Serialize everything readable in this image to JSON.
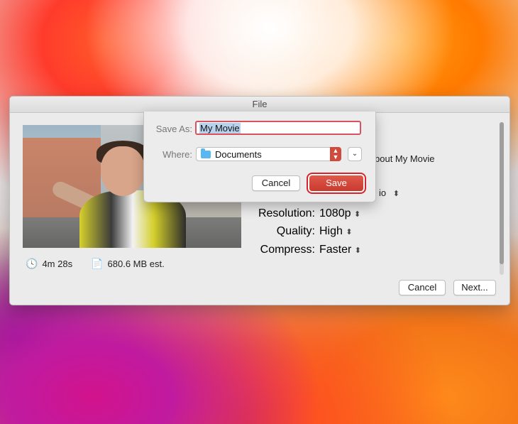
{
  "window": {
    "title": "File"
  },
  "video": {
    "duration": "4m 28s",
    "size": "680.6 MB est."
  },
  "settings": {
    "about_fragment": "bout My Movie",
    "format_fragment": "io",
    "resolution": {
      "label": "Resolution:",
      "value": "1080p"
    },
    "quality": {
      "label": "Quality:",
      "value": "High"
    },
    "compress": {
      "label": "Compress:",
      "value": "Faster"
    }
  },
  "buttons": {
    "cancel": "Cancel",
    "next": "Next..."
  },
  "save_sheet": {
    "save_as_label": "Save As:",
    "save_as_value": "My Movie",
    "where_label": "Where:",
    "where_value": "Documents",
    "cancel": "Cancel",
    "save": "Save"
  },
  "icons": {
    "clock": "clock-icon",
    "file": "document-icon",
    "folder": "folder-icon",
    "stepper": "stepper-icon"
  },
  "colors": {
    "save_accent": "#d14b3d",
    "highlight_ring": "#d9232c"
  }
}
